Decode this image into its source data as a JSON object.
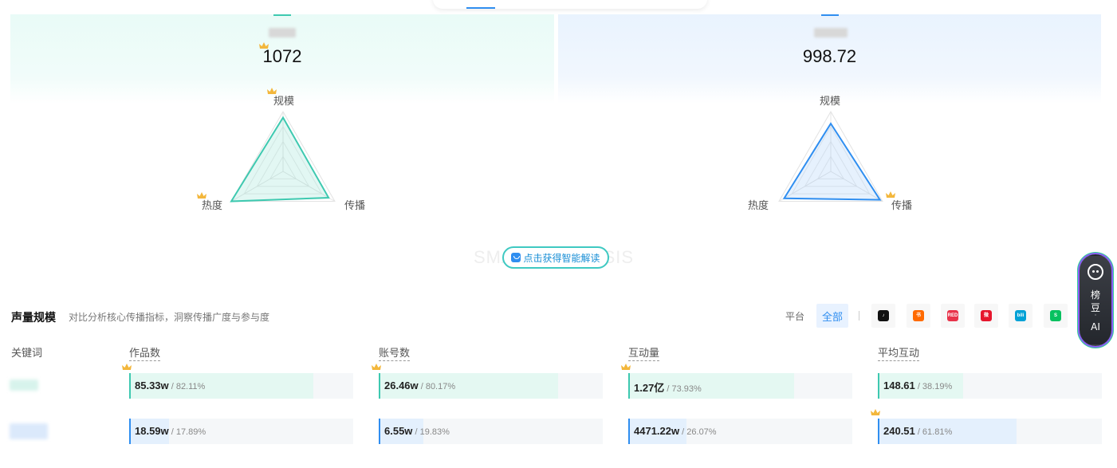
{
  "colors": {
    "teal": "#3ec9b0",
    "blue": "#2f8ef0",
    "crown": "#f3b73c"
  },
  "compare": {
    "left": {
      "score": "1072",
      "color": "#3ec9b0",
      "radar": {
        "scale": 0.9,
        "spread": 0.88,
        "heat": 1.0
      }
    },
    "right": {
      "score": "998.72",
      "color": "#2f8ef0",
      "radar": {
        "scale": 0.8,
        "spread": 0.95,
        "heat": 0.9
      }
    }
  },
  "radar_axes": {
    "top": "规模",
    "right": "传播",
    "left": "热度"
  },
  "ai_read_button": "点击获得智能解读",
  "watermark": "SMART ANALYSIS",
  "section": {
    "title": "声量规模",
    "desc": "对比分析核心传播指标，洞察传播广度与参与度"
  },
  "platform": {
    "label": "平台",
    "all": "全部",
    "icons": [
      {
        "name": "douyin-icon",
        "color": "#111111",
        "glyph": "♪"
      },
      {
        "name": "xiaohongshu-icon",
        "color": "#ff6a00",
        "glyph": "书"
      },
      {
        "name": "redbook-icon",
        "color": "#e8334a",
        "glyph": "RED"
      },
      {
        "name": "weibo-icon",
        "color": "#e6162d",
        "glyph": "微"
      },
      {
        "name": "bilibili-icon",
        "color": "#00a1d6",
        "glyph": "bili"
      },
      {
        "name": "wechat-icon",
        "color": "#07c160",
        "glyph": "S"
      }
    ]
  },
  "ai_float": {
    "line1": "榜",
    "line2": "豆",
    "line3": "AI"
  },
  "table": {
    "keyword_header": "关键词",
    "headers": [
      "作品数",
      "账号数",
      "互动量",
      "平均互动"
    ],
    "rows": [
      {
        "cells": [
          {
            "value": "85.33w",
            "pct": "82.11%",
            "ratio": 0.8211,
            "crown": true
          },
          {
            "value": "26.46w",
            "pct": "80.17%",
            "ratio": 0.8017,
            "crown": true
          },
          {
            "value": "1.27亿",
            "pct": "73.93%",
            "ratio": 0.7393,
            "crown": true
          },
          {
            "value": "148.61",
            "pct": "38.19%",
            "ratio": 0.3819,
            "crown": false
          }
        ]
      },
      {
        "cells": [
          {
            "value": "18.59w",
            "pct": "17.89%",
            "ratio": 0.1789,
            "crown": false
          },
          {
            "value": "6.55w",
            "pct": "19.83%",
            "ratio": 0.1983,
            "crown": false
          },
          {
            "value": "4471.22w",
            "pct": "26.07%",
            "ratio": 0.2607,
            "crown": false
          },
          {
            "value": "240.51",
            "pct": "61.81%",
            "ratio": 0.6181,
            "crown": true
          }
        ]
      }
    ]
  }
}
